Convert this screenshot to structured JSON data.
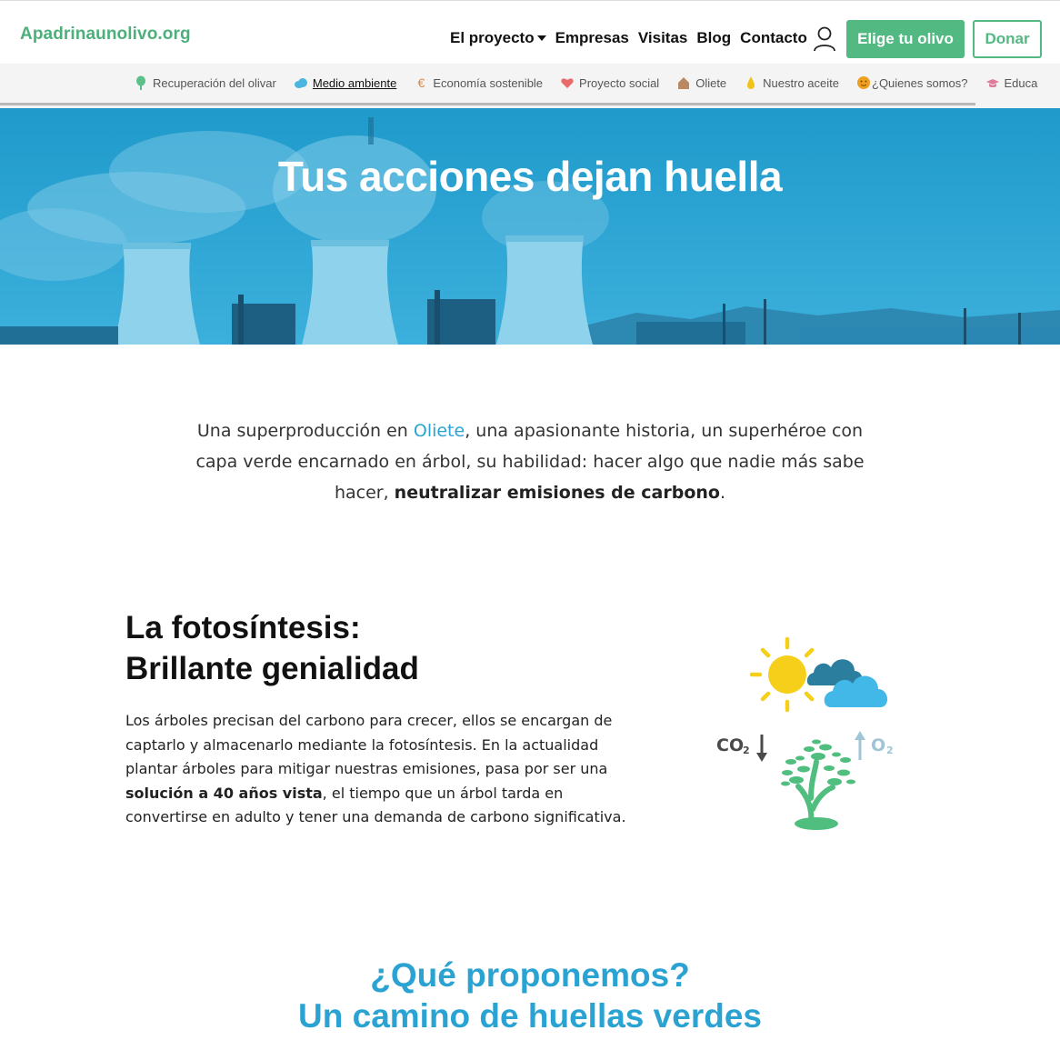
{
  "header": {
    "logo": "Apadrinaunolivo.org",
    "nav": [
      {
        "label": "El proyecto",
        "has_dropdown": true
      },
      {
        "label": "Empresas"
      },
      {
        "label": "Visitas"
      },
      {
        "label": "Blog"
      },
      {
        "label": "Contacto"
      }
    ],
    "user_icon": "user-icon",
    "cta_primary": "Elige tu olivo",
    "cta_secondary": "Donar",
    "colors": {
      "brand_green": "#52b983",
      "accent_blue": "#2aa3d3"
    }
  },
  "subnav": {
    "items": [
      {
        "label": "Recuperación del olivar",
        "icon": "tree-icon",
        "active": false
      },
      {
        "label": "Medio ambiente",
        "icon": "cloud-icon",
        "active": true
      },
      {
        "label": "Economía sostenible",
        "icon": "euro-icon",
        "active": false
      },
      {
        "label": "Proyecto social",
        "icon": "heart-icon",
        "active": false
      },
      {
        "label": "Oliete",
        "icon": "house-icon",
        "active": false
      },
      {
        "label": "Nuestro aceite",
        "icon": "oil-drop-icon",
        "active": false
      },
      {
        "label": "¿Quienes somos?",
        "icon": "smiley-icon",
        "active": false
      },
      {
        "label": "Educa",
        "icon": "graduation-cap-icon",
        "active": false
      }
    ]
  },
  "hero": {
    "title": "Tus acciones dejan huella"
  },
  "intro": {
    "part1": "Una superproducción en ",
    "link": "Oliete",
    "part2": ", una apasionante historia, un superhéroe con capa verde encarnado en árbol, su habilidad: hacer algo que nadie más sabe hacer, ",
    "bold": "neutralizar emisiones de carbono",
    "part3": "."
  },
  "photosynthesis": {
    "title_line1": "La fotosíntesis:",
    "title_line2": "Brillante genialidad",
    "text1": "Los árboles precisan del carbono para crecer, ellos se encargan de captarlo y almacenarlo mediante la fotosíntesis. En la actualidad plantar árboles para mitigar nuestras emisiones, pasa por ser una ",
    "text_bold": "solución a 40 años vista",
    "text2": ", el tiempo que un árbol tarda en convertirse en adulto y tener una demanda de carbono significativa.",
    "illustration": {
      "co2_label": "CO",
      "co2_sub": "2",
      "o2_label": "O",
      "o2_sub": "2"
    }
  },
  "proposal": {
    "title_line1": "¿Qué proponemos?",
    "title_line2": "Un camino de huellas verdes"
  }
}
